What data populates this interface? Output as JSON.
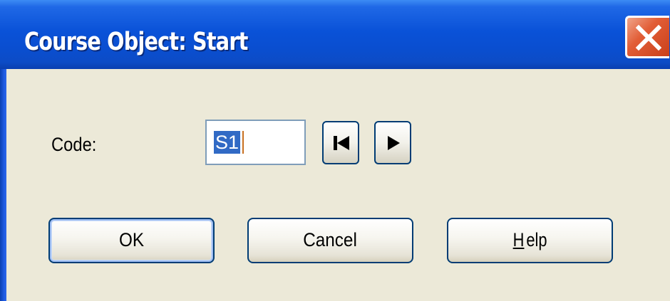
{
  "window": {
    "title": "Course Object: Start"
  },
  "form": {
    "code_label": "Code:",
    "code_value": "S1"
  },
  "buttons": {
    "ok": "OK",
    "cancel": "Cancel",
    "help_mnemonic": "H",
    "help_rest": "elp"
  },
  "icons": {
    "close": "close-icon",
    "first": "skip-to-first-icon",
    "next": "play-next-icon"
  },
  "colors": {
    "titlebar": "#0a52d8",
    "close": "#e25d36",
    "dialog_bg": "#ece9d8",
    "selection": "#316ac5"
  }
}
